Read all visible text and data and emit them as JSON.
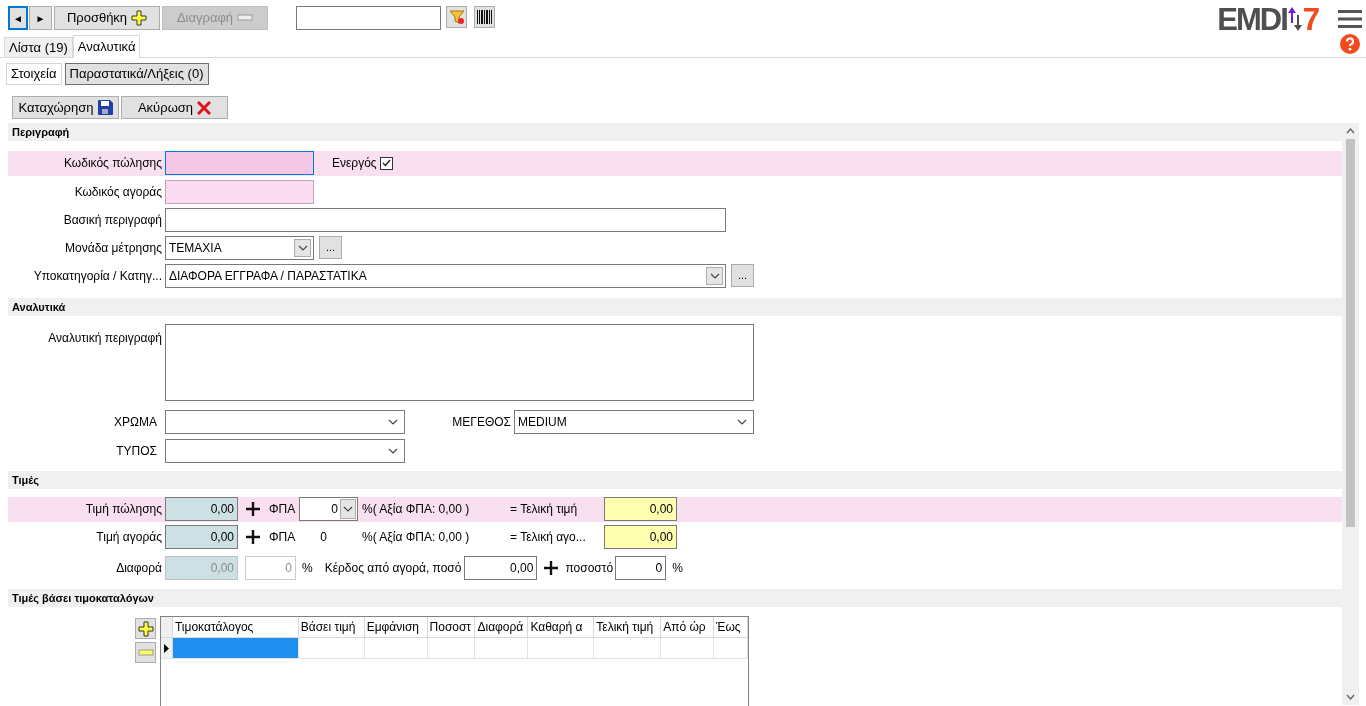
{
  "nav": {
    "prev": "◄",
    "next": "►"
  },
  "toolbar": [
    {
      "label": "Προσθήκη",
      "disabled": false
    },
    {
      "label": "Διαγραφή",
      "disabled": true
    }
  ],
  "logo": {
    "text": "EMDI",
    "suffix": "7"
  },
  "tabs": [
    {
      "label": "Λίστα (19)",
      "selected": false
    },
    {
      "label": "Αναλυτικά",
      "selected": true
    }
  ],
  "subtabs": [
    {
      "label": "Στοιχεία",
      "selected": true
    },
    {
      "label": "Παραστατικά/Λήξεις (0)",
      "selected": false
    }
  ],
  "actions": [
    {
      "label": "Καταχώρηση"
    },
    {
      "label": "Ακύρωση"
    }
  ],
  "description": {
    "title": "Περιγραφή",
    "sale_code": {
      "label": "Κωδικός πώλησης",
      "focused": true,
      "highlight": true
    },
    "active": {
      "label": "Ενεργός",
      "checked": true
    },
    "purchase_code": {
      "label": "Κωδικός αγοράς"
    },
    "basic_description": {
      "label": "Βασική περιγραφή"
    },
    "unit": {
      "label": "Μονάδα μέτρησης",
      "value": "ΤΕΜΑΧΙΑ",
      "more": "..."
    },
    "category": {
      "label": "Υποκατηγορία / Κατηγ...",
      "value": "ΔΙΑΦΟΡΑ ΕΓΓΡΑΦΑ / ΠΑΡΑΣΤΑΤΙΚΑ",
      "more": "..."
    }
  },
  "details": {
    "title": "Αναλυτικά",
    "long_description": {
      "label": "Αναλυτική περιγραφή"
    },
    "color": {
      "label": "ΧΡΩΜΑ"
    },
    "size": {
      "label": "ΜΕΓΕΘΟΣ",
      "value": "MEDIUM"
    },
    "type": {
      "label": "ΤΥΠΟΣ"
    }
  },
  "prices": {
    "title": "Τιμές",
    "rows": [
      {
        "label": "Τιμή πώλησης",
        "value": "0,00",
        "vat_label": "ΦΠΑ",
        "vat": "0",
        "kind": "select",
        "vat_amount": "%( Αξία ΦΠΑ: 0,00 )",
        "final_label": "= Τελική τιμή",
        "final": "0,00",
        "highlight": true
      },
      {
        "label": "Τιμή αγοράς",
        "value": "0,00",
        "vat_label": "ΦΠΑ",
        "vat": "0",
        "kind": "text",
        "vat_amount": "%( Αξία ΦΠΑ: 0,00 )",
        "final_label": "= Τελική αγο...",
        "final": "0,00",
        "highlight": false
      }
    ],
    "difference": {
      "label": "Διαφορά",
      "value": "0,00",
      "disabled": true,
      "percent": "0",
      "percent_sign": "%",
      "profit_label": "Κέρδος από αγορά, ποσό",
      "profit": "0,00",
      "rate_label": "ποσοστό",
      "rate": "0",
      "rate_sign": "%"
    }
  },
  "price_lists": {
    "title": "Τιμές βάσει τιμοκαταλόγων",
    "columns": [
      "Τιμοκατάλογος",
      "Βάσει τιμή",
      "Εμφάνιση",
      "Ποσοστ",
      "Διαφορά",
      "Καθαρή α",
      "Τελική τιμή",
      "Από ώρ",
      "Έως"
    ],
    "rows": [
      {
        "selected": true
      }
    ]
  }
}
